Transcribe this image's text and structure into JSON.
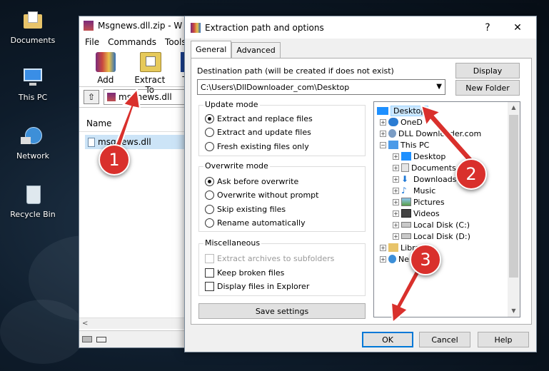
{
  "desktop": {
    "icons": [
      {
        "label": "Documents",
        "icon": "folder-icon"
      },
      {
        "label": "This PC",
        "icon": "computer-icon"
      },
      {
        "label": "Network",
        "icon": "network-icon"
      },
      {
        "label": "Recycle Bin",
        "icon": "recycle-bin-icon"
      }
    ]
  },
  "winrar": {
    "title": "Msgnews.dll.zip - W",
    "menu": [
      "File",
      "Commands",
      "Tools"
    ],
    "toolbar": {
      "add": "Add",
      "extract_to": "Extract To",
      "third": "T"
    },
    "path": "msgnews.dll",
    "column_name": "Name",
    "file": "msgnews.dll"
  },
  "dialog": {
    "title": "Extraction path and options",
    "help_btn": "?",
    "close_btn": "✕",
    "tabs": [
      "General",
      "Advanced"
    ],
    "destination_label": "Destination path (will be created if does not exist)",
    "destination_value": "C:\\Users\\DllDownloader_com\\Desktop",
    "display_btn": "Display",
    "new_folder_btn": "New Folder",
    "update_mode": {
      "label": "Update mode",
      "options": [
        "Extract and replace files",
        "Extract and update files",
        "Fresh existing files only"
      ],
      "selected": 0
    },
    "overwrite_mode": {
      "label": "Overwrite mode",
      "options": [
        "Ask before overwrite",
        "Overwrite without prompt",
        "Skip existing files",
        "Rename automatically"
      ],
      "selected": 0
    },
    "misc": {
      "label": "Miscellaneous",
      "options": [
        "Extract archives to subfolders",
        "Keep broken files",
        "Display files in Explorer"
      ]
    },
    "save_settings_btn": "Save settings",
    "tree": [
      {
        "label": "Desktop",
        "selected": true
      },
      {
        "label": "OneD"
      },
      {
        "label": "DLL Downloader.com"
      },
      {
        "label": "This PC"
      },
      {
        "label": "Desktop"
      },
      {
        "label": "Documents"
      },
      {
        "label": "Downloads"
      },
      {
        "label": "Music"
      },
      {
        "label": "Pictures"
      },
      {
        "label": "Videos"
      },
      {
        "label": "Local Disk (C:)"
      },
      {
        "label": "Local Disk (D:)"
      },
      {
        "label": "Libraries"
      },
      {
        "label": "Ne"
      }
    ],
    "ok_btn": "OK",
    "cancel_btn": "Cancel",
    "help_bottom_btn": "Help"
  },
  "annotations": [
    "1",
    "2",
    "3"
  ],
  "colors": {
    "badge": "#d9302c",
    "accent": "#0078d7"
  }
}
